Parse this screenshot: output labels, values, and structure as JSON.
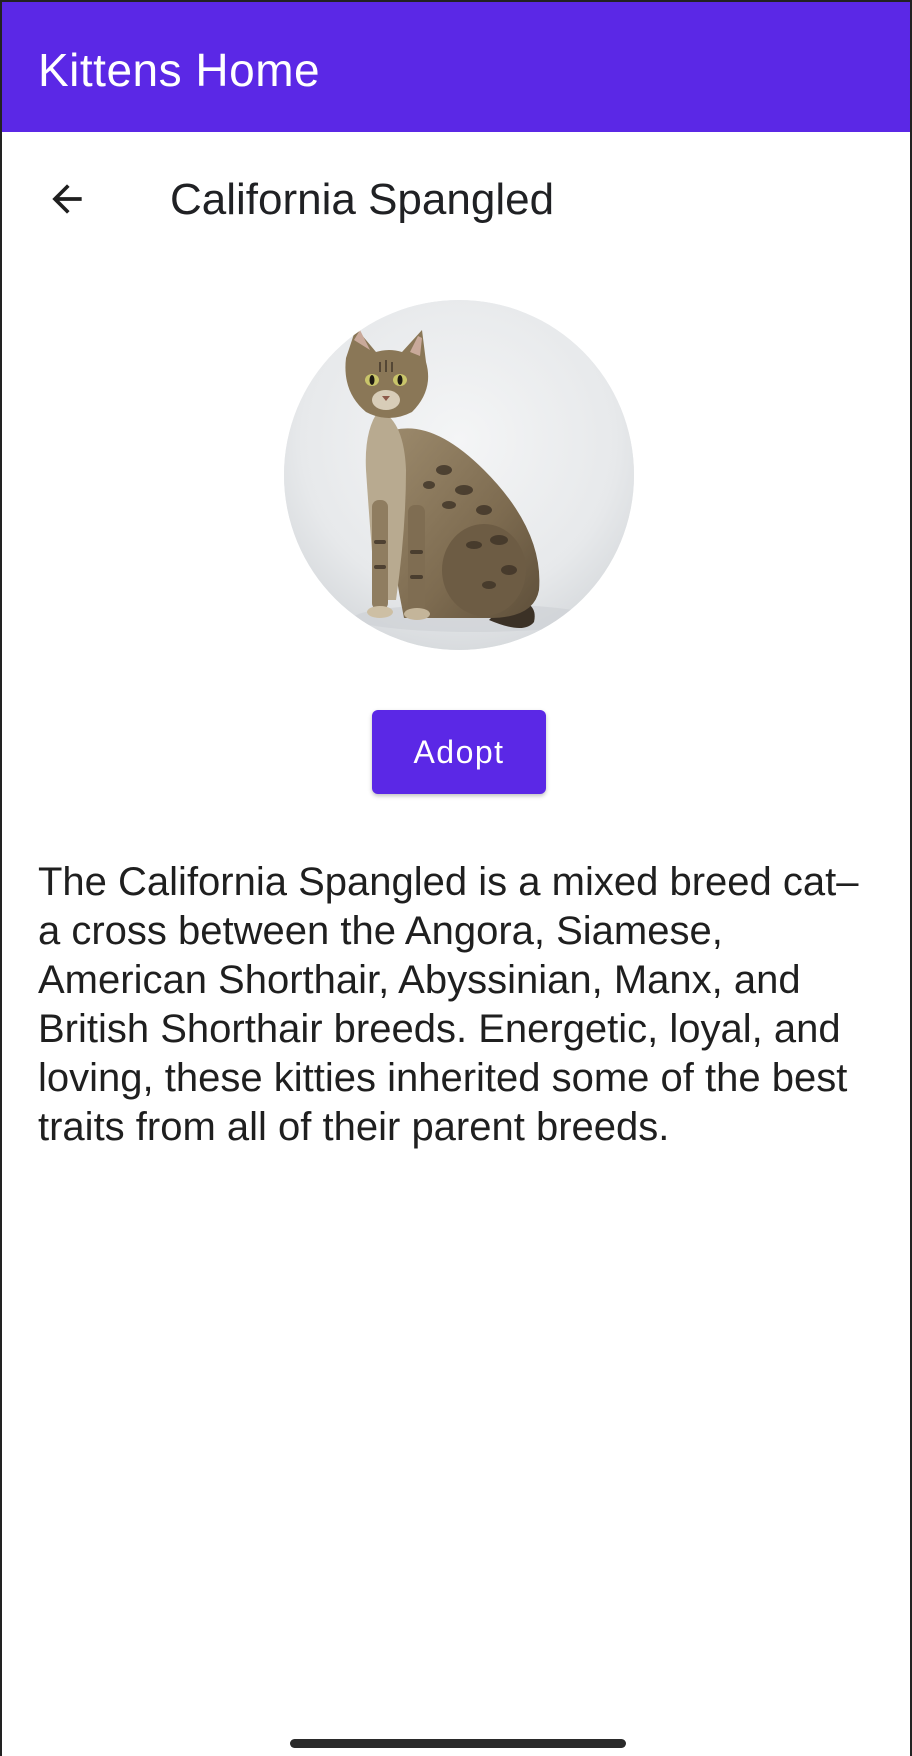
{
  "app_bar": {
    "title": "Kittens Home",
    "color": "#5b28e6"
  },
  "toolbar": {
    "back_icon": "arrow-back-icon",
    "title": "California Spangled"
  },
  "cat": {
    "image_icon": "cat-photo"
  },
  "adopt_button": {
    "label": "Adopt",
    "color": "#5b28e6"
  },
  "description": "The California Spangled is a mixed breed cat–a cross between the Angora, Siamese, American Shorthair, Abyssinian, Manx, and British Shorthair breeds. Energetic, loyal, and loving, these kitties inherited some of the best traits from all of their parent breeds."
}
